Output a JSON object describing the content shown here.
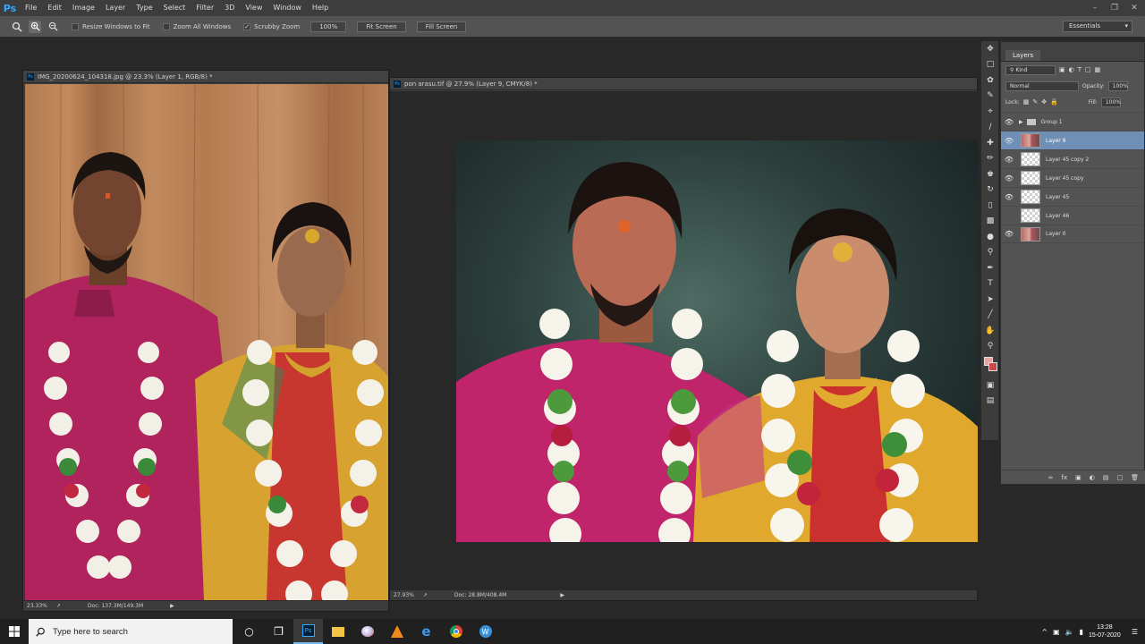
{
  "app": {
    "logo": "Ps"
  },
  "menu": [
    "File",
    "Edit",
    "Image",
    "Layer",
    "Type",
    "Select",
    "Filter",
    "3D",
    "View",
    "Window",
    "Help"
  ],
  "options": {
    "resize_windows": "Resize Windows to Fit",
    "zoom_all": "Zoom All Windows",
    "scrubby_zoom": "Scrubby Zoom",
    "zoom_value": "100%",
    "fit_screen": "Fit Screen",
    "fill_screen": "Fill Screen",
    "workspace": "Essentials"
  },
  "documents": [
    {
      "title": "IMG_20200624_104318.jpg @ 23.3% (Layer 1, RGB/8) *",
      "zoom": "23.33%",
      "doc_size": "Doc: 137.3M/149.3M"
    },
    {
      "title": "pon arasu.tif @ 27.9% (Layer 9, CMYK/8) *",
      "zoom": "27.93%",
      "doc_size": "Doc: 28.8M/408.4M"
    }
  ],
  "layers_panel": {
    "tab": "Layers",
    "filter": "Kind",
    "blend_mode": "Normal",
    "opacity_label": "Opacity:",
    "opacity_value": "100%",
    "lock_label": "Lock:",
    "fill_label": "Fill:",
    "fill_value": "100%",
    "layers": [
      {
        "name": "Group 1",
        "type": "group",
        "visible": true,
        "selected": false
      },
      {
        "name": "Layer 9",
        "type": "photo",
        "visible": true,
        "selected": true
      },
      {
        "name": "Layer 45 copy 2",
        "type": "transparent",
        "visible": true,
        "selected": false
      },
      {
        "name": "Layer 45 copy",
        "type": "transparent",
        "visible": true,
        "selected": false
      },
      {
        "name": "Layer 45",
        "type": "transparent",
        "visible": true,
        "selected": false
      },
      {
        "name": "Layer 46",
        "type": "transparent",
        "visible": false,
        "selected": false
      },
      {
        "name": "Layer 0",
        "type": "photo",
        "visible": true,
        "selected": false
      }
    ]
  },
  "colors": {
    "foreground": "#e8a3a0",
    "background": "#c7494f",
    "accent": "#31a8ff"
  },
  "taskbar": {
    "search_placeholder": "Type here to search",
    "time": "13:28",
    "date": "15-07-2020"
  }
}
